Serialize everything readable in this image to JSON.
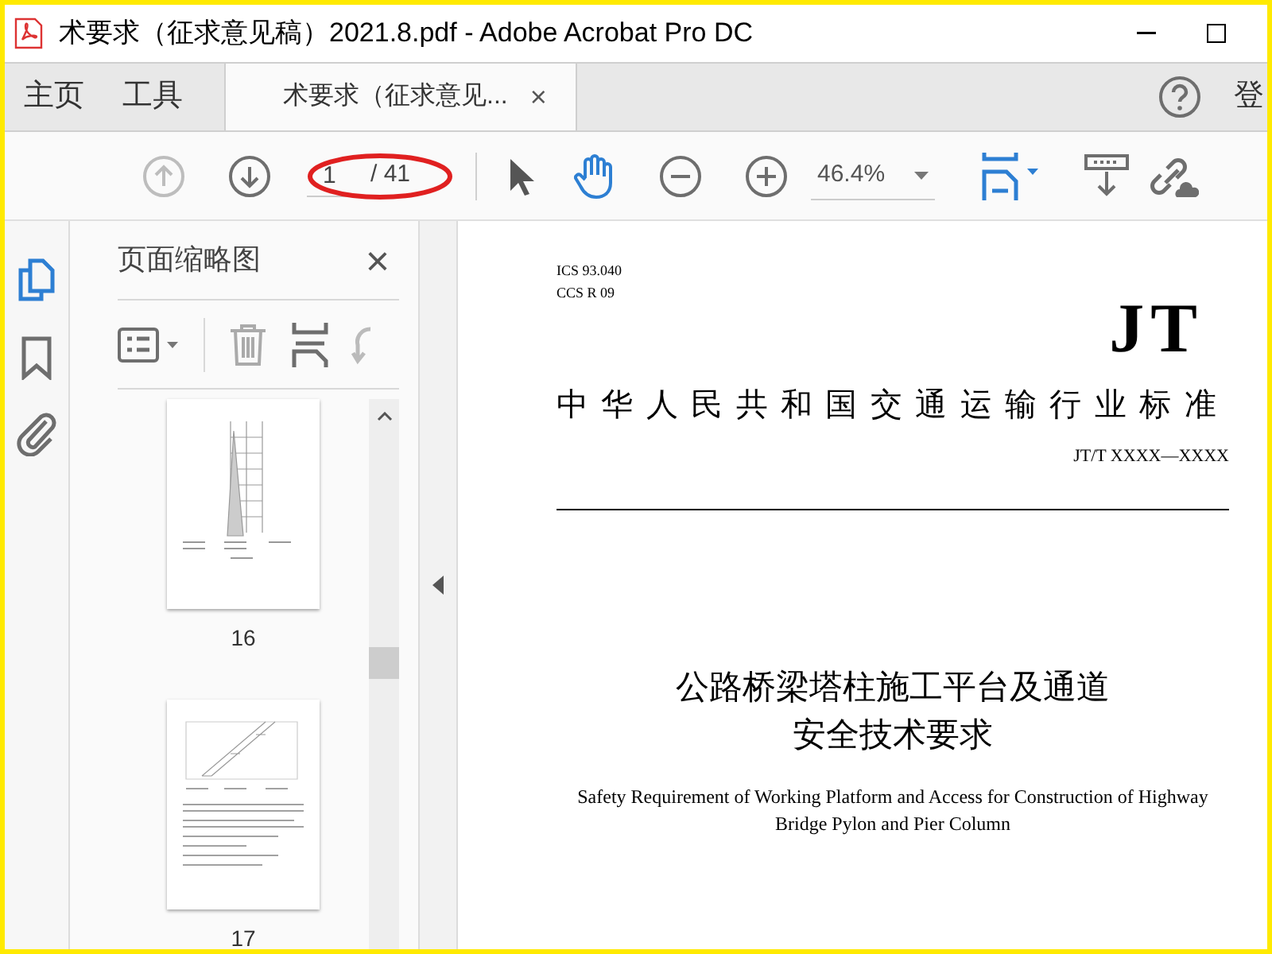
{
  "window": {
    "title": "术要求（征求意见稿）2021.8.pdf - Adobe Acrobat Pro DC"
  },
  "tabs": [
    {
      "label": "主页",
      "selected": false,
      "kind": "nav"
    },
    {
      "label": "工具",
      "selected": false,
      "kind": "nav"
    },
    {
      "label": "术要求（征求意见...",
      "selected": true,
      "kind": "doc",
      "close": "×"
    }
  ],
  "account_label": "登",
  "toolbar": {
    "page_current": "1",
    "page_total": "/ 41",
    "zoom": "46.4%",
    "prev_disabled": true
  },
  "side_rail": [
    {
      "kind": "pages",
      "selected": true
    },
    {
      "kind": "bookmark",
      "selected": false
    },
    {
      "kind": "attachment",
      "selected": false
    }
  ],
  "thumbnails_panel": {
    "title": "页面缩略图",
    "close": "×",
    "thumbnails": [
      {
        "label": "16",
        "selected": false,
        "kind": "tower"
      },
      {
        "label": "17",
        "selected": false,
        "kind": "stairs"
      }
    ]
  },
  "document": {
    "ics": "ICS  93.040",
    "ccs": "CCS R 09",
    "logo": "JT",
    "header": "中华人民共和国交通运输行业标准",
    "code": "JT/T XXXX—XXXX",
    "title_lines": [
      "公路桥梁塔柱施工平台及通道",
      "安全技术要求"
    ],
    "english_title": "Safety Requirement of Working Platform and Access for Construction of Highway Bridge Pylon and Pier Column"
  }
}
